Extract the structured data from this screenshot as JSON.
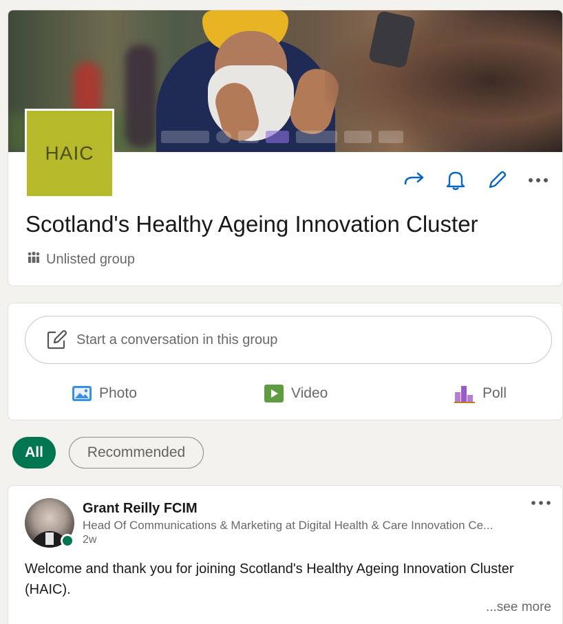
{
  "group": {
    "avatar_text": "HAIC",
    "title": "Scotland's Healthy Ageing Innovation Cluster",
    "type_label": "Unlisted group",
    "actions": [
      "share-icon",
      "bell-icon",
      "pencil-icon",
      "more-icon"
    ]
  },
  "composer": {
    "placeholder": "Start a conversation in this group",
    "photo_label": "Photo",
    "video_label": "Video",
    "poll_label": "Poll"
  },
  "filters": {
    "all_label": "All",
    "recommended_label": "Recommended"
  },
  "post": {
    "author": "Grant Reilly FCIM",
    "headline": "Head Of Communications & Marketing at Digital Health & Care Innovation Ce...",
    "time": "2w",
    "body": "Welcome and thank you for joining Scotland's Healthy Ageing Innovation Cluster (HAIC).",
    "see_more": "...see more"
  },
  "colors": {
    "accent_blue": "#0a66c2",
    "accent_green": "#01754f",
    "haic_bg": "#b6ba2a",
    "photo_icon": "#378fe9",
    "video_icon": "#5f9b41",
    "poll_icon": "#c37d16"
  }
}
